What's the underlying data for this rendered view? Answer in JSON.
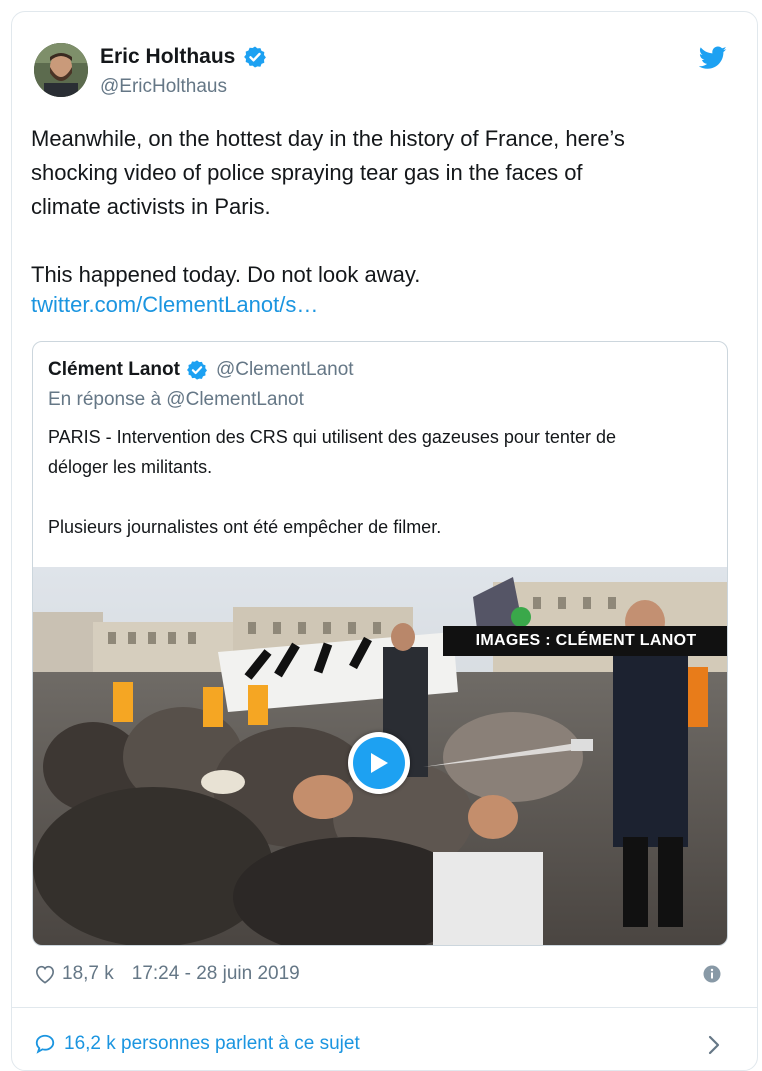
{
  "author": {
    "name": "Eric Holthaus",
    "handle": "@EricHolthaus"
  },
  "tweet": {
    "text": "Meanwhile, on the hottest day in the history of France, here’s\nshocking video of police spraying tear gas in the faces of\nclimate activists in Paris.\n\nThis happened today. Do not look away.",
    "link": "twitter.com/ClementLanot/s…"
  },
  "quoted": {
    "name": "Clément Lanot",
    "handle": "@ClementLanot",
    "reply_to": "En réponse à @ClementLanot",
    "text": "PARIS - Intervention des CRS qui utilisent des gazeuses pour tenter de\ndéloger les militants.\n\nPlusieurs journalistes ont été empêcher de filmer.",
    "media_overlay": "IMAGES : CLÉMENT LANOT"
  },
  "meta": {
    "likes": "18,7 k",
    "timestamp": "17:24 - 28 juin 2019"
  },
  "conversation": {
    "label": "16,2 k personnes parlent à ce sujet"
  },
  "colors": {
    "link": "#1b95e0",
    "verified": "#1da1f2",
    "secondary_text": "#657786",
    "border": "#e1e8ed"
  },
  "icons": [
    "verified-badge-icon",
    "twitter-bird-icon",
    "play-icon",
    "heart-icon",
    "info-icon",
    "comment-bubble-icon",
    "chevron-right-icon"
  ]
}
